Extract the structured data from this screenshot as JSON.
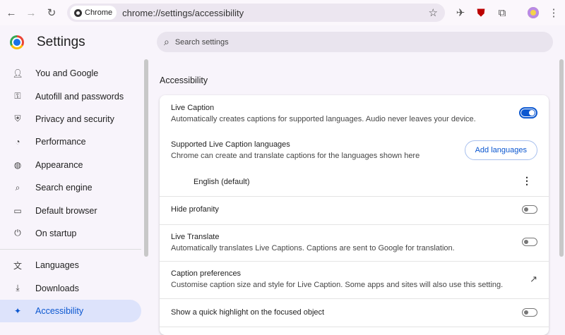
{
  "browser": {
    "chip": "Chrome",
    "url": "chrome://settings/accessibility"
  },
  "header": {
    "title": "Settings",
    "search_placeholder": "Search settings"
  },
  "sidebar": {
    "items": [
      {
        "label": "You and Google",
        "icon": "G"
      },
      {
        "label": "Autofill and passwords",
        "icon": "⚿"
      },
      {
        "label": "Privacy and security",
        "icon": "⛨"
      },
      {
        "label": "Performance",
        "icon": "◔"
      },
      {
        "label": "Appearance",
        "icon": "🎨"
      },
      {
        "label": "Search engine",
        "icon": "⌕"
      },
      {
        "label": "Default browser",
        "icon": "▭"
      },
      {
        "label": "On startup",
        "icon": "⏻"
      },
      {
        "label": "Languages",
        "icon": "文"
      },
      {
        "label": "Downloads",
        "icon": "⤓"
      },
      {
        "label": "Accessibility",
        "icon": "♿"
      }
    ]
  },
  "main": {
    "section_title": "Accessibility",
    "live_caption": {
      "label": "Live Caption",
      "sub": "Automatically creates captions for supported languages. Audio never leaves your device.",
      "on": true
    },
    "languages": {
      "label": "Supported Live Caption languages",
      "sub": "Chrome can create and translate captions for the languages shown here",
      "button": "Add languages",
      "item": "English (default)"
    },
    "hide_profanity": {
      "label": "Hide profanity",
      "on": false
    },
    "live_translate": {
      "label": "Live Translate",
      "sub": "Automatically translates Live Captions. Captions are sent to Google for translation.",
      "on": false
    },
    "caption_prefs": {
      "label": "Caption preferences",
      "sub": "Customise caption size and style for Live Caption. Some apps and sites will also use this setting."
    },
    "highlight": {
      "label": "Show a quick highlight on the focused object",
      "on": false
    }
  }
}
